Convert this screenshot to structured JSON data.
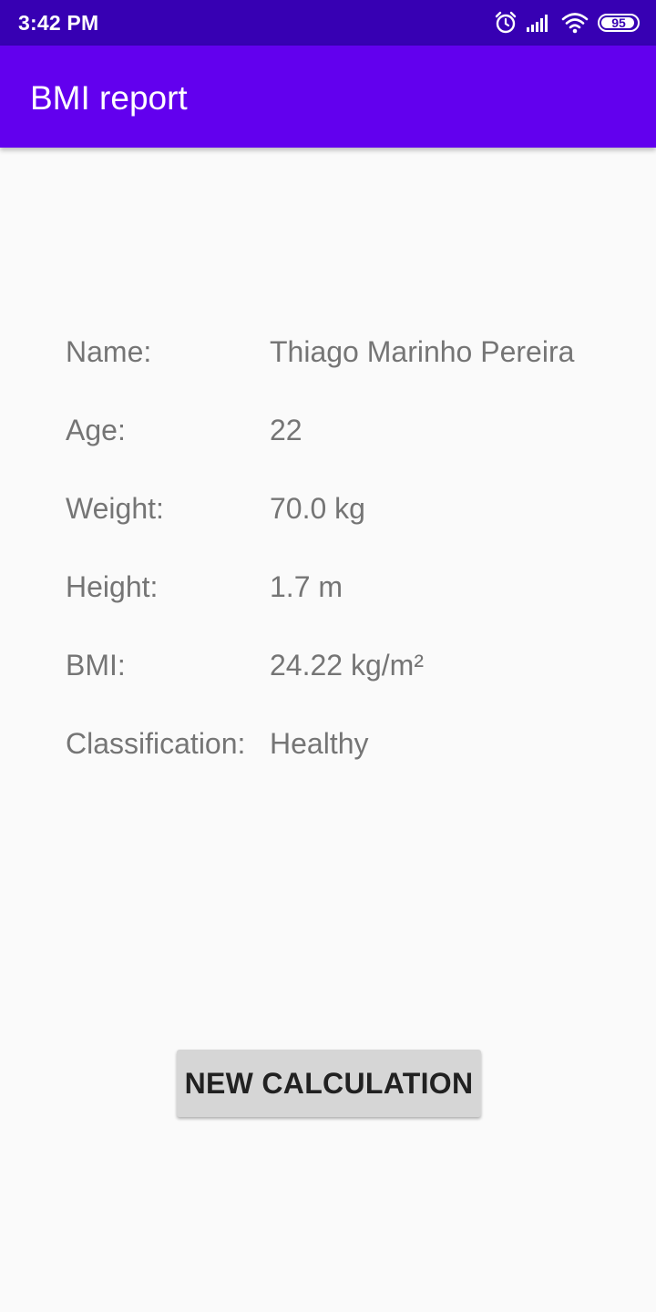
{
  "status_bar": {
    "time": "3:42 PM",
    "battery_level": 95,
    "battery_text": "95",
    "icons": [
      "alarm-icon",
      "signal-icon",
      "wifi-icon",
      "battery-icon"
    ]
  },
  "app_bar": {
    "title": "BMI report"
  },
  "report": {
    "rows": [
      {
        "label": "Name:",
        "value": "Thiago Marinho Pereira"
      },
      {
        "label": "Age:",
        "value": "22"
      },
      {
        "label": "Weight:",
        "value": "70.0 kg"
      },
      {
        "label": "Height:",
        "value": "1.7 m"
      },
      {
        "label": "BMI:",
        "value": "24.22 kg/m²"
      },
      {
        "label": "Classification:",
        "value": "Healthy"
      }
    ]
  },
  "actions": {
    "new_calculation_label": "NEW CALCULATION"
  },
  "colors": {
    "status_bar": "#3700b3",
    "app_bar": "#6200ee",
    "background": "#fafafa",
    "text_secondary": "#757575",
    "button": "#d6d6d6"
  }
}
